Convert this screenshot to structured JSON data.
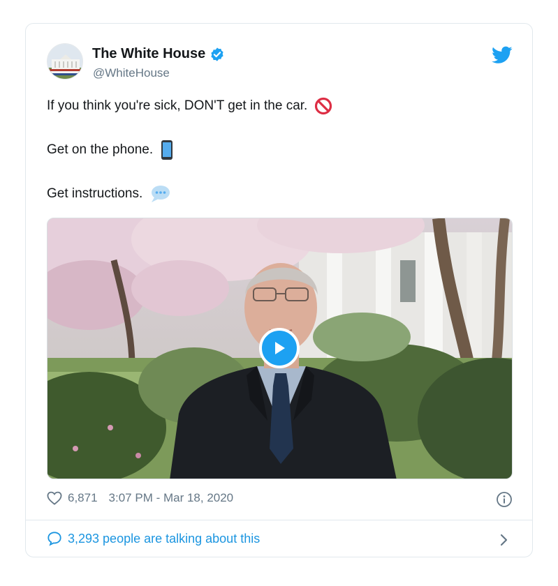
{
  "author": {
    "display_name": "The White House",
    "handle": "@WhiteHouse",
    "verified": true
  },
  "tweet": {
    "lines": [
      {
        "text": "If you think you're sick, DON'T get in the car.",
        "emoji": "no-entry-sign-icon"
      },
      {
        "text": "Get on the phone.",
        "emoji": "mobile-phone-icon"
      },
      {
        "text": "Get instructions.",
        "emoji": "speech-balloon-icon"
      }
    ],
    "media": {
      "type": "video"
    }
  },
  "meta": {
    "like_count": "6,871",
    "timestamp": "3:07 PM - Mar 18, 2020"
  },
  "footer": {
    "talking_text": "3,293 people are talking about this"
  },
  "colors": {
    "brand_blue": "#1da1f2",
    "link_blue": "#1b95e0",
    "muted": "#657786",
    "no_entry_red": "#dd2e44"
  }
}
